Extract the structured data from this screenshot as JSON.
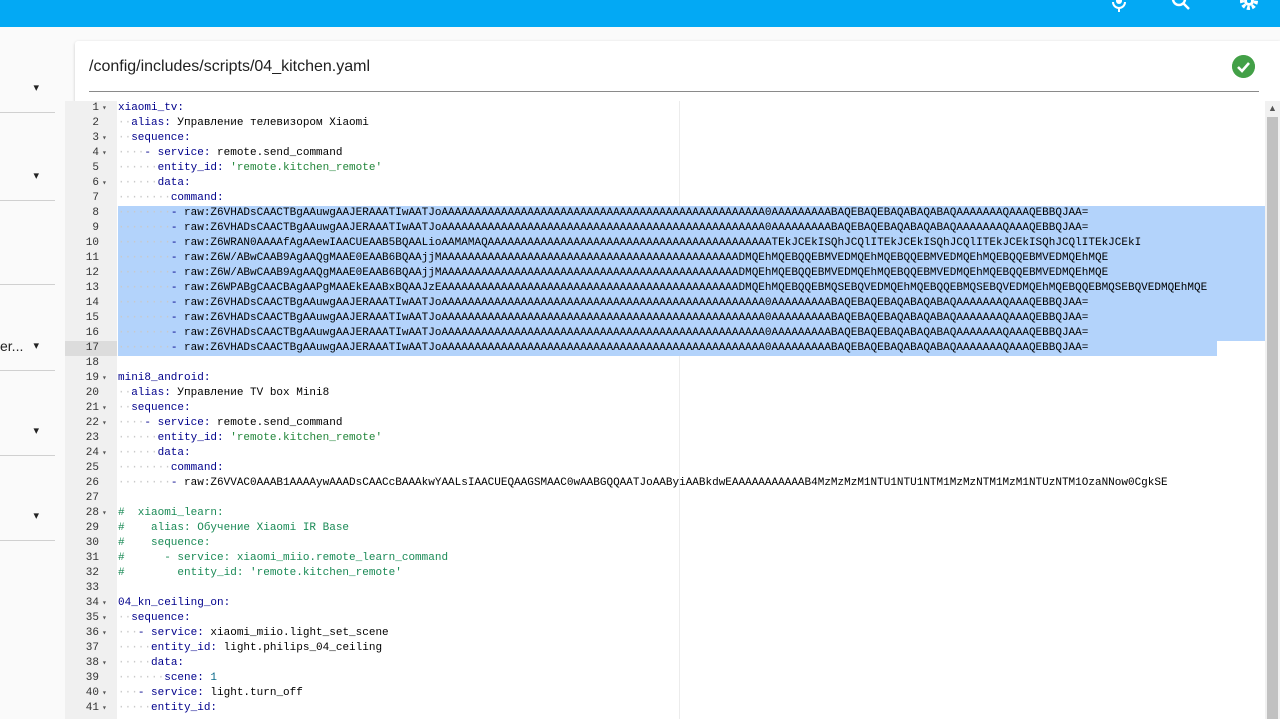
{
  "colors": {
    "topbar": "#03a9f4",
    "selection": "#b3d3fb",
    "success": "#43a047"
  },
  "topbar": {
    "icons": [
      "microphone-icon",
      "search-icon",
      "gear-icon"
    ]
  },
  "sidebar": {
    "truncated_label": "er...",
    "dropdown_icon": "▾"
  },
  "file": {
    "path": "/config/includes/scripts/04_kitchen.yaml",
    "status_icon": "check-circle-icon"
  },
  "editor": {
    "lines": [
      {
        "n": "1",
        "fold": "▾",
        "text": "xiaomi_tv:"
      },
      {
        "n": "2",
        "fold": "",
        "text": "  alias: Управление телевизором Xiaomi"
      },
      {
        "n": "3",
        "fold": "▾",
        "text": "  sequence:"
      },
      {
        "n": "4",
        "fold": "▾",
        "text": "    - service: remote.send_command"
      },
      {
        "n": "5",
        "fold": "",
        "text": "      entity_id: 'remote.kitchen_remote'"
      },
      {
        "n": "6",
        "fold": "▾",
        "text": "      data:"
      },
      {
        "n": "7",
        "fold": "",
        "text": "        command:"
      },
      {
        "n": "8",
        "fold": "",
        "text": "        - raw:Z6VHADsCAACTBgAAuwgAAJERAAATIwAATJoAAAAAAAAAAAAAAAAAAAAAAAAAAAAAAAAAAAAAAAAAAAAAAAAA0AAAAAAAAABAQEBAQEBAQABAQABAQAAAAAAAQAAAQEBBQJAA="
      },
      {
        "n": "9",
        "fold": "",
        "text": "        - raw:Z6VHADsCAACTBgAAuwgAAJERAAATIwAATJoAAAAAAAAAAAAAAAAAAAAAAAAAAAAAAAAAAAAAAAAAAAAAAAAA0AAAAAAAAABAQEBAQEBAQABAQABAQAAAAAAAQAAAQEBBQJAA="
      },
      {
        "n": "10",
        "fold": "",
        "text": "        - raw:Z6WRAN0AAAAfAgAAewIAACUEAAB5BQAALioAAMAMAQAAAAAAAAAAAAAAAAAAAAAAAAAAAAAAAAAAAAAAAAAAATEkJCEkISQhJCQlITEkJCEkISQhJCQlITEkJCEkISQhJCQlITEkJCEkI"
      },
      {
        "n": "11",
        "fold": "",
        "text": "        - raw:Z6W/ABwCAAB9AgAAQgMAAE0EAAB6BQAAjjMAAAAAAAAAAAAAAAAAAAAAAAAAAAAAAAAAAAAAAAAAAAAADMQEhMQEBQQEBMVEDMQEhMQEBQQEBMVEDMQEhMQEBQQEBMVEDMQEhMQE"
      },
      {
        "n": "12",
        "fold": "",
        "text": "        - raw:Z6W/ABwCAAB9AgAAQgMAAE0EAAB6BQAAjjMAAAAAAAAAAAAAAAAAAAAAAAAAAAAAAAAAAAAAAAAAAAAADMQEhMQEBQQEBMVEDMQEhMQEBQQEBMVEDMQEhMQEBQQEBMVEDMQEhMQE"
      },
      {
        "n": "13",
        "fold": "",
        "text": "        - raw:Z6WPABgCAACBAgAAPgMAAEkEAABxBQAAJzEAAAAAAAAAAAAAAAAAAAAAAAAAAAAAAAAAAAAAAAAAAAAADMQEhMQEBQQEBMQSEBQVEDMQEhMQEBQQEBMQSEBQVEDMQEhMQEBQQEBMQSEBQVEDMQEhMQE"
      },
      {
        "n": "14",
        "fold": "",
        "text": "        - raw:Z6VHADsCAACTBgAAuwgAAJERAAATIwAATJoAAAAAAAAAAAAAAAAAAAAAAAAAAAAAAAAAAAAAAAAAAAAAAAAA0AAAAAAAAABAQEBAQEBAQABAQABAQAAAAAAAQAAAQEBBQJAA="
      },
      {
        "n": "15",
        "fold": "",
        "text": "        - raw:Z6VHADsCAACTBgAAuwgAAJERAAATIwAATJoAAAAAAAAAAAAAAAAAAAAAAAAAAAAAAAAAAAAAAAAAAAAAAAAA0AAAAAAAAABAQEBAQEBAQABAQABAQAAAAAAAQAAAQEBBQJAA="
      },
      {
        "n": "16",
        "fold": "",
        "text": "        - raw:Z6VHADsCAACTBgAAuwgAAJERAAATIwAATJoAAAAAAAAAAAAAAAAAAAAAAAAAAAAAAAAAAAAAAAAAAAAAAAAA0AAAAAAAAABAQEBAQEBAQABAQABAQAAAAAAAQAAAQEBBQJAA="
      },
      {
        "n": "17",
        "fold": "",
        "text": "        - raw:Z6VHADsCAACTBgAAuwgAAJERAAATIwAATJoAAAAAAAAAAAAAAAAAAAAAAAAAAAAAAAAAAAAAAAAAAAAAAAAA0AAAAAAAAABAQEBAQEBAQABAQABAQAAAAAAAQAAAQEBBQJAA="
      },
      {
        "n": "18",
        "fold": "",
        "text": ""
      },
      {
        "n": "19",
        "fold": "▾",
        "text": "mini8_android:"
      },
      {
        "n": "20",
        "fold": "",
        "text": "  alias: Управление TV box Mini8"
      },
      {
        "n": "21",
        "fold": "▾",
        "text": "  sequence:"
      },
      {
        "n": "22",
        "fold": "▾",
        "text": "    - service: remote.send_command"
      },
      {
        "n": "23",
        "fold": "",
        "text": "      entity_id: 'remote.kitchen_remote'"
      },
      {
        "n": "24",
        "fold": "▾",
        "text": "      data:"
      },
      {
        "n": "25",
        "fold": "",
        "text": "        command:"
      },
      {
        "n": "26",
        "fold": "",
        "text": "        - raw:Z6VVAC0AAAB1AAAAywAAADsCAACcBAAAkwYAALsIAACUEQAAGSMAAC0wAABGQQAATJoAAByiAABkdwEAAAAAAAAAAAB4MzMzMzM1NTU1NTU1NTM1MzMzNTM1MzM1NTUzNTM1OzaNNow0CgkSE"
      },
      {
        "n": "27",
        "fold": "",
        "text": ""
      },
      {
        "n": "28",
        "fold": "▾",
        "text": "#  xiaomi_learn:"
      },
      {
        "n": "29",
        "fold": "",
        "text": "#    alias: Обучение Xiaomi IR Base"
      },
      {
        "n": "30",
        "fold": "",
        "text": "#    sequence:"
      },
      {
        "n": "31",
        "fold": "",
        "text": "#      - service: xiaomi_miio.remote_learn_command"
      },
      {
        "n": "32",
        "fold": "",
        "text": "#        entity_id: 'remote.kitchen_remote'"
      },
      {
        "n": "33",
        "fold": "",
        "text": ""
      },
      {
        "n": "34",
        "fold": "▾",
        "text": "04_kn_ceiling_on:"
      },
      {
        "n": "35",
        "fold": "▾",
        "text": "  sequence:"
      },
      {
        "n": "36",
        "fold": "▾",
        "text": "   - service: xiaomi_miio.light_set_scene"
      },
      {
        "n": "37",
        "fold": "",
        "text": "     entity_id: light.philips_04_ceiling"
      },
      {
        "n": "38",
        "fold": "▾",
        "text": "     data:"
      },
      {
        "n": "39",
        "fold": "",
        "text": "       scene: 1"
      },
      {
        "n": "40",
        "fold": "▾",
        "text": "   - service: light.turn_off"
      },
      {
        "n": "41",
        "fold": "▾",
        "text": "     entity_id:"
      }
    ],
    "selected_lines": [
      8,
      17
    ],
    "current_line": 17
  }
}
